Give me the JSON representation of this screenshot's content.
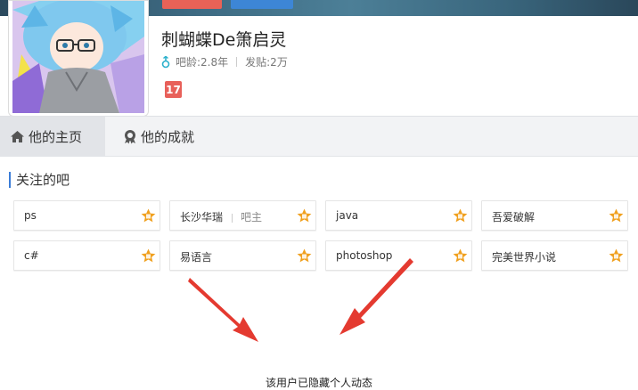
{
  "header": {
    "username": "刺蝴蝶De箫启灵",
    "bar_age_label": "吧龄:2.8年",
    "post_count_label": "发贴:2万",
    "badge_text": "17"
  },
  "tabs": [
    {
      "label": "他的主页",
      "active": true
    },
    {
      "label": "他的成就",
      "active": false
    }
  ],
  "section": {
    "title": "关注的吧"
  },
  "bars": [
    {
      "name": "ps",
      "role": ""
    },
    {
      "name": "长沙华瑞",
      "role": "吧主"
    },
    {
      "name": "java",
      "role": ""
    },
    {
      "name": "吾爱破解",
      "role": ""
    },
    {
      "name": "c#",
      "role": ""
    },
    {
      "name": "易语言",
      "role": ""
    },
    {
      "name": "photoshop",
      "role": ""
    },
    {
      "name": "完美世界小说",
      "role": ""
    }
  ],
  "hidden_message": "该用户已隐藏个人动态",
  "colors": {
    "accent_blue": "#3b7dd8",
    "follow_red": "#e86257",
    "level_orange": "#f0a01e",
    "arrow_red": "#e43a30"
  }
}
